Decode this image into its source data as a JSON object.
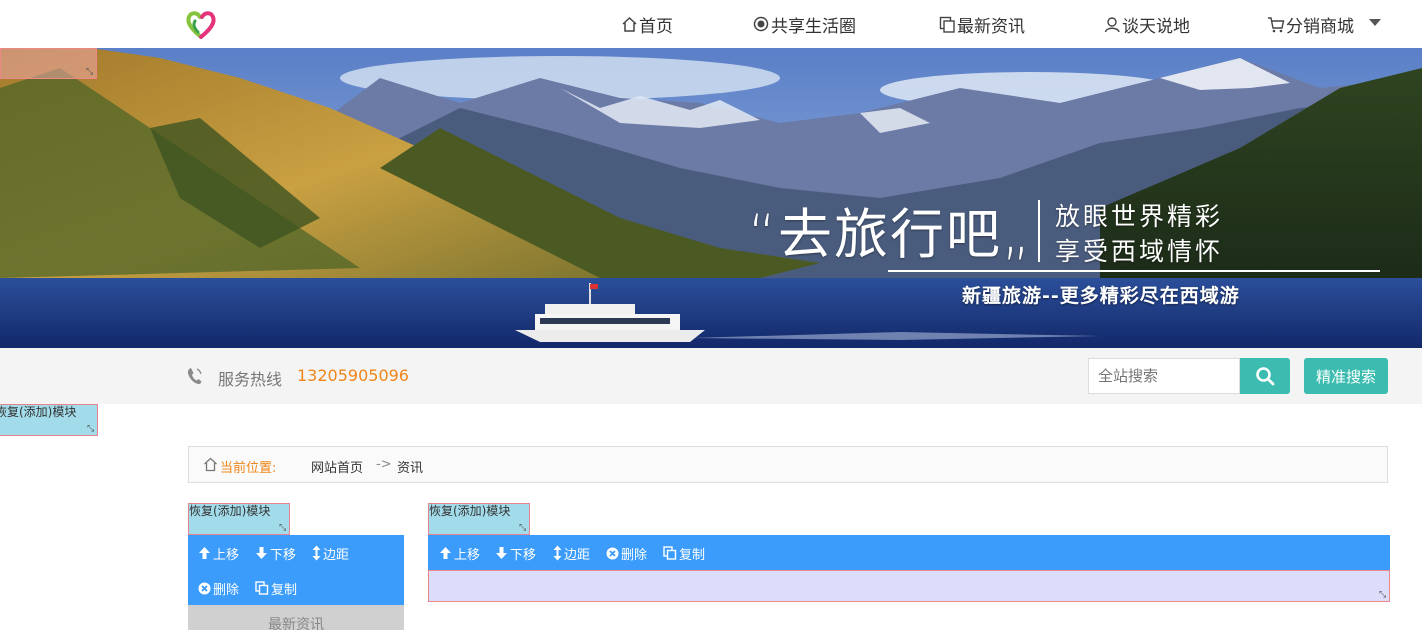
{
  "header": {
    "nav": [
      {
        "label": "首页",
        "icon": "home-icon"
      },
      {
        "label": "共享生活圈",
        "icon": "target-icon"
      },
      {
        "label": "最新资讯",
        "icon": "copy-icon"
      },
      {
        "label": "谈天说地",
        "icon": "chat-user-icon"
      },
      {
        "label": "分销商城",
        "icon": "cart-icon"
      }
    ]
  },
  "banner": {
    "slogan_main": "“去旅行吧„",
    "slogan_right_1": "放眼世界精彩",
    "slogan_right_2": "享受西域情怀",
    "slogan_sub": "新疆旅游--更多精彩尽在西域游"
  },
  "service": {
    "hotline_label": "服务热线",
    "hotline_number": "13205905096",
    "search_placeholder": "全站搜索",
    "precise_search_label": "精准搜索"
  },
  "module_tag_label": "恢复(添加)模块",
  "breadcrumb": {
    "label": "当前位置:",
    "home": "网站首页",
    "separator": "->",
    "current": "资讯"
  },
  "toolbar": {
    "move_up": "上移",
    "move_down": "下移",
    "margin": "边距",
    "delete": "删除",
    "copy": "复制"
  },
  "left_panel": {
    "title": "最新资讯"
  },
  "colors": {
    "accent_teal": "#3cbcb0",
    "toolbar_blue": "#3c9cfb",
    "hotline_orange": "#f08519",
    "module_tag_bg": "#a2dbe9"
  }
}
